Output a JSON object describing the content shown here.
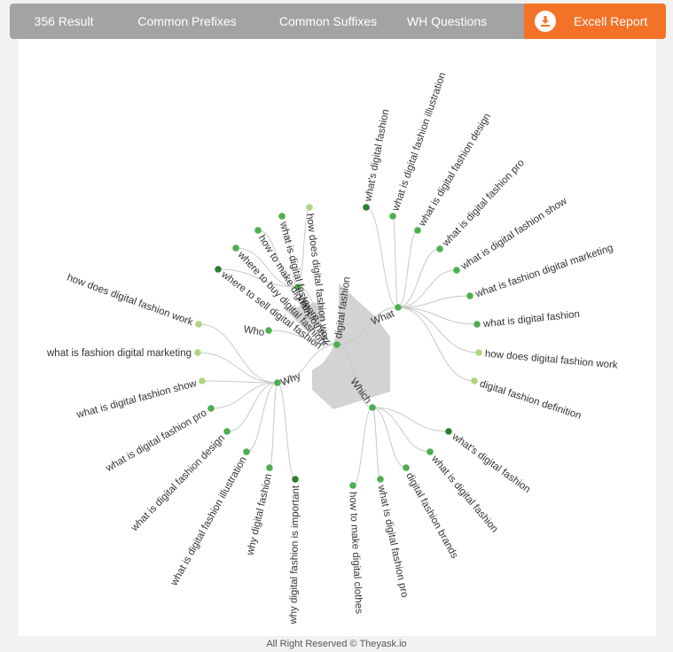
{
  "tabs": {
    "result": "356 Result",
    "prefixes": "Common Prefixes",
    "suffixes": "Common Suffixes",
    "wh": "WH Questions",
    "excel": "Excell Report"
  },
  "colors": {
    "tab_bg": "#a3a3a3",
    "accent": "#f47227",
    "link": "#c8c8c8",
    "center_shape": "#d3d3d3",
    "node_dark": "#2e7d32",
    "node_mid": "#4caf50",
    "node_light": "#aed581"
  },
  "icons": {
    "excel": "download-icon"
  },
  "tree": {
    "root": "digital fashion",
    "branches": [
      {
        "label": "Where",
        "keywords": [
          "where to sell digital fashion",
          "where to buy digital fashion",
          "how to make digital clothes",
          "what is digital fashion",
          "how does digital fashion work"
        ]
      },
      {
        "label": "What",
        "keywords": [
          "what's digital fashion",
          "what is digital fashion illustration",
          "what is digital fashion design",
          "what is digital fashion pro",
          "what is digital fashion show",
          "what is fashion digital marketing",
          "what is digital fashion",
          "how does digital fashion work",
          "digital fashion definition"
        ]
      },
      {
        "label": "Which",
        "keywords": [
          "what's digital fashion",
          "what is digital fashion",
          "digital fashion brands",
          "what is digital fashion pro",
          "how to make digital clothes"
        ]
      },
      {
        "label": "Why",
        "keywords": [
          "how does digital fashion work",
          "what is fashion digital marketing",
          "what is digital fashion show",
          "what is digital fashion pro",
          "what is digital fashion design",
          "what is digital fashion illustration",
          "why digital fashion",
          "why digital fashion is important"
        ]
      },
      {
        "label": "Who",
        "keywords": []
      }
    ]
  },
  "footer": "All Right Reserved © Theyask.io"
}
